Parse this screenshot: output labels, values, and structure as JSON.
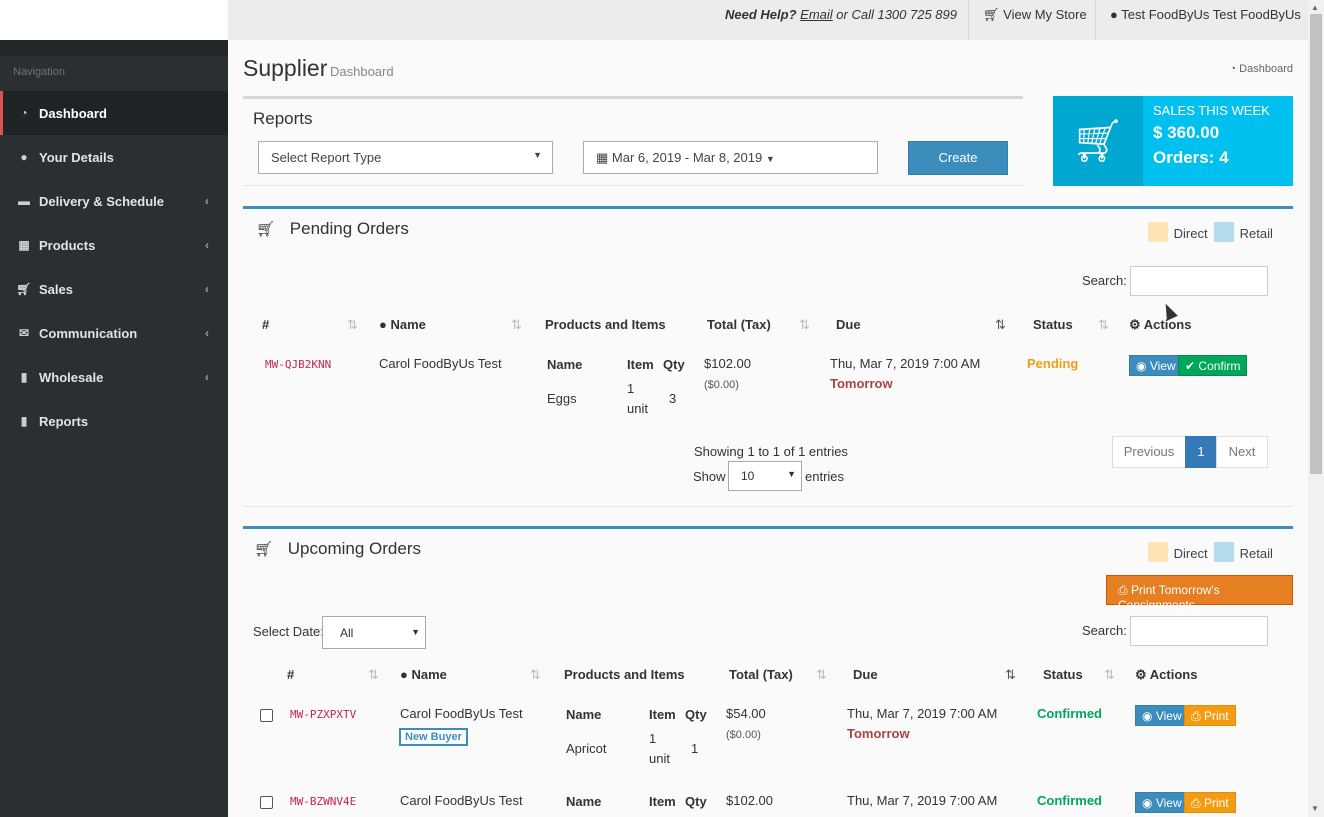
{
  "sidebar": {
    "heading": "Navigation",
    "items": [
      {
        "label": "Dashboard",
        "icon": "dashboard-icon"
      },
      {
        "label": "Your Details",
        "icon": "user-icon"
      },
      {
        "label": "Delivery & Schedule",
        "icon": "truck-icon"
      },
      {
        "label": "Products",
        "icon": "cubes-icon"
      },
      {
        "label": "Sales",
        "icon": "cart-icon"
      },
      {
        "label": "Communication",
        "icon": "envelope-icon"
      },
      {
        "label": "Wholesale",
        "icon": "bar-chart-icon"
      },
      {
        "label": "Reports",
        "icon": "bar-chart-icon"
      }
    ]
  },
  "topbar": {
    "help_prefix": "Need Help?",
    "email_link": "Email",
    "call_text": "or Call 1300 725 899",
    "store_link": "View My Store",
    "user_link": "Test FoodByUs Test FoodByUs"
  },
  "page": {
    "title": "Supplier",
    "subtitle": "Dashboard",
    "breadcrumb": "Dashboard"
  },
  "reports": {
    "title": "Reports",
    "type_placeholder": "Select Report Type",
    "date_range": "Mar 6, 2019 - Mar 8, 2019",
    "create_label": "Create"
  },
  "sales_week": {
    "label": "SALES THIS WEEK",
    "amount": "$ 360.00",
    "orders": "Orders: 4"
  },
  "pending": {
    "title": "Pending Orders",
    "legend_direct": "Direct",
    "legend_retail": "Retail",
    "search_label": "Search:",
    "columns": [
      "#",
      "Name",
      "Products and Items",
      "Total (Tax)",
      "Due",
      "Status",
      "Actions"
    ],
    "rows": [
      {
        "id": "MW-QJB2KNN",
        "name": "Carol FoodByUs Test",
        "product_header": {
          "name": "Name",
          "item": "Item",
          "qty": "Qty"
        },
        "product_name": "Eggs",
        "item_l1": "1",
        "item_l2": "unit",
        "qty": "3",
        "total": "$102.00",
        "tax": "($0.00)",
        "due": "Thu, Mar 7, 2019 7:00 AM",
        "due_rel": "Tomorrow",
        "status": "Pending",
        "view": "View",
        "confirm": "Confirm"
      }
    ],
    "showing": "Showing 1 to 1 of 1 entries",
    "show_label": "Show",
    "show_value": "10",
    "entries_label": "entries",
    "pager": {
      "prev": "Previous",
      "current": "1",
      "next": "Next"
    }
  },
  "upcoming": {
    "title": "Upcoming Orders",
    "legend_direct": "Direct",
    "legend_retail": "Retail",
    "print_tomorrow": "Print Tomorrow's Consignments",
    "select_date_label": "Select Date:",
    "select_date_value": "All",
    "search_label": "Search:",
    "columns": [
      "#",
      "Name",
      "Products and Items",
      "Total (Tax)",
      "Due",
      "Status",
      "Actions"
    ],
    "rows": [
      {
        "id": "MW-PZXPXTV",
        "name": "Carol FoodByUs Test",
        "badge": "New Buyer",
        "product_header": {
          "name": "Name",
          "item": "Item",
          "qty": "Qty"
        },
        "product_name": "Apricot",
        "item_l1": "1",
        "item_l2": "unit",
        "qty": "1",
        "total": "$54.00",
        "tax": "($0.00)",
        "due": "Thu, Mar 7, 2019 7:00 AM",
        "due_rel": "Tomorrow",
        "status": "Confirmed",
        "view": "View",
        "print": "Print"
      },
      {
        "id": "MW-BZWNV4E",
        "name": "Carol FoodByUs Test",
        "product_header": {
          "name": "Name",
          "item": "Item",
          "qty": "Qty"
        },
        "total": "$102.00",
        "due": "Thu, Mar 7, 2019 7:00 AM",
        "status": "Confirmed",
        "view": "View",
        "print": "Print"
      }
    ]
  },
  "colors": {
    "sidebar_bg": "#2a3032",
    "accent_blue": "#3c8dbc",
    "sales_box": "#00c0ef",
    "pending_orange": "#f39c12",
    "confirmed_green": "#00a65a",
    "direct_swatch": "#fce4b6",
    "retail_swatch": "#b3dcee"
  }
}
